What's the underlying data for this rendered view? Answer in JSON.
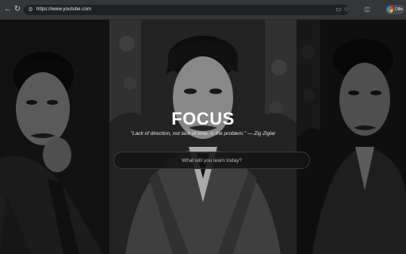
{
  "browser": {
    "url": "https://www.youtube.com",
    "profile_label": "Ollie",
    "icons": {
      "back": "back-arrow-icon",
      "reload": "reload-icon",
      "site_info": "tune-icon",
      "cast": "cast-icon",
      "bookmark": "star-icon",
      "sidebar": "side-panel-icon"
    }
  },
  "hero": {
    "title": "FOCUS",
    "quote": "\"Lack of direction, not lack of time, is the problem.\" — Zig Ziglar"
  },
  "search": {
    "placeholder": "What will you learn today?"
  }
}
